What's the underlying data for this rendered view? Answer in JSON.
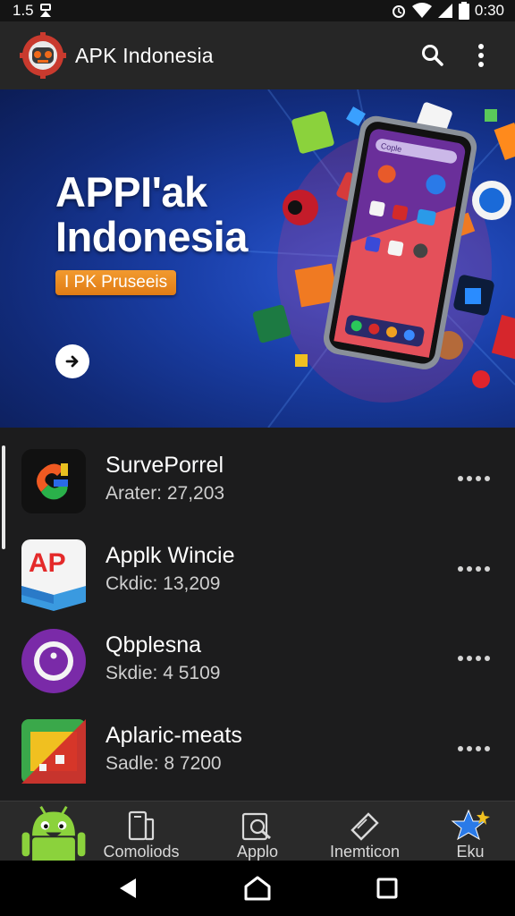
{
  "status_bar": {
    "time_left": "1.5",
    "time_right": "0:30"
  },
  "app_bar": {
    "title": "APK Indonesia",
    "icons": [
      "robot-logo",
      "search-icon",
      "more-vert-icon"
    ]
  },
  "banner": {
    "title_line1": "APPI'ak",
    "title_line2": "Indonesia",
    "pill_label": "I PK Pruseeis",
    "phone_search": "Cople",
    "colors": {
      "pill": "#e8861f",
      "background": "#1a3fa8"
    }
  },
  "apps": [
    {
      "name": "SurvePorrel",
      "meta": "Arater: 27,203",
      "icon": "multicolor-s-icon"
    },
    {
      "name": "Applk Wincie",
      "meta": "Ckdic: 13,209",
      "icon": "ap-red-icon"
    },
    {
      "name": "Qbplesna",
      "meta": "Skdie: 4 5109",
      "icon": "purple-circle-icon"
    },
    {
      "name": "Aplaric-meats",
      "meta": "Sadle: 8 7200",
      "icon": "green-red-square-icon"
    }
  ],
  "bottom_nav": [
    {
      "label": "",
      "icon": "android-icon"
    },
    {
      "label": "Comoliods",
      "icon": "phone-icon"
    },
    {
      "label": "Applo",
      "icon": "search-box-icon"
    },
    {
      "label": "Inemticon",
      "icon": "tag-icon"
    },
    {
      "label": "Eku",
      "icon": "star-icon"
    }
  ],
  "system_nav": [
    "back-icon",
    "home-icon",
    "recents-icon"
  ]
}
